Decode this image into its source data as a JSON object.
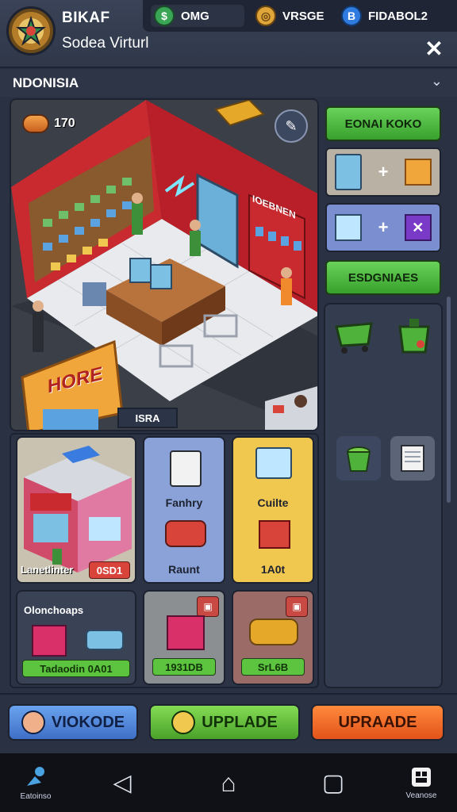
{
  "header": {
    "app_name": "BIKAF",
    "subtitle": "Sodea Virturl",
    "resources": [
      {
        "icon": "cash-icon",
        "value": "OMG",
        "color": "#3aa655"
      },
      {
        "icon": "gold-coin-icon",
        "value": "VRSGE",
        "color": "#e0a63a"
      },
      {
        "icon": "gem-icon",
        "value": "FIDABOL2",
        "color": "#2f7be0"
      }
    ],
    "close_label": "✕"
  },
  "region": {
    "label": "NDONISIA",
    "chevron": "⌄"
  },
  "scene": {
    "counter": "170",
    "edit_icon": "pencil-icon",
    "store_sign": "HORE",
    "sign_right": "IOEBNEN",
    "tag": "ISRA"
  },
  "right_panel": {
    "top_button": "EONAI KOKO",
    "combos": [
      {
        "left_icon": "fridge-icon",
        "plus": "+",
        "right_icon": "box-icon"
      },
      {
        "left_icon": "cube-icon",
        "plus": "+",
        "right_icon": "shuffle-icon"
      }
    ],
    "second_button": "ESDGNIAES",
    "equipment": [
      "cart-green-icon",
      "bin-green-icon",
      "bucket-icon",
      "shelf-white-icon"
    ]
  },
  "cards": [
    {
      "title": "",
      "label": "Lanetlinter",
      "price": "0SD1",
      "icon": "store-building-icon",
      "bg": "#c9c2b0"
    },
    {
      "title": "Fanhry",
      "label": "Raunt",
      "price": "",
      "icon": "printer-icon",
      "bg": "#8aa2d8"
    },
    {
      "title": "Cuilte",
      "label": "1A0t",
      "price": "",
      "icon": "monitor-icon",
      "bg": "#f0c84f"
    },
    {
      "title": "Olonchoaps",
      "label": "",
      "price": "Tadaodin  0A01",
      "icon": "gift-box-icon",
      "bg": "#3a4256"
    },
    {
      "title": "",
      "label": "",
      "price": "1931DB",
      "icon": "register-icon",
      "bg": "#8c8f92"
    },
    {
      "title": "",
      "label": "",
      "price": "SrL6B",
      "icon": "yellow-car-icon",
      "bg": "#9a6b67"
    }
  ],
  "actions": [
    {
      "label": "VIOKODE",
      "icon": "hand-icon"
    },
    {
      "label": "UPPLADE",
      "icon": "wrench-icon"
    },
    {
      "label": "UPRAADE",
      "icon": ""
    }
  ],
  "nav": {
    "left_label": "Eatoinso",
    "right_label": "Veanose",
    "back": "◁",
    "home": "⌂",
    "recents": "▢"
  }
}
